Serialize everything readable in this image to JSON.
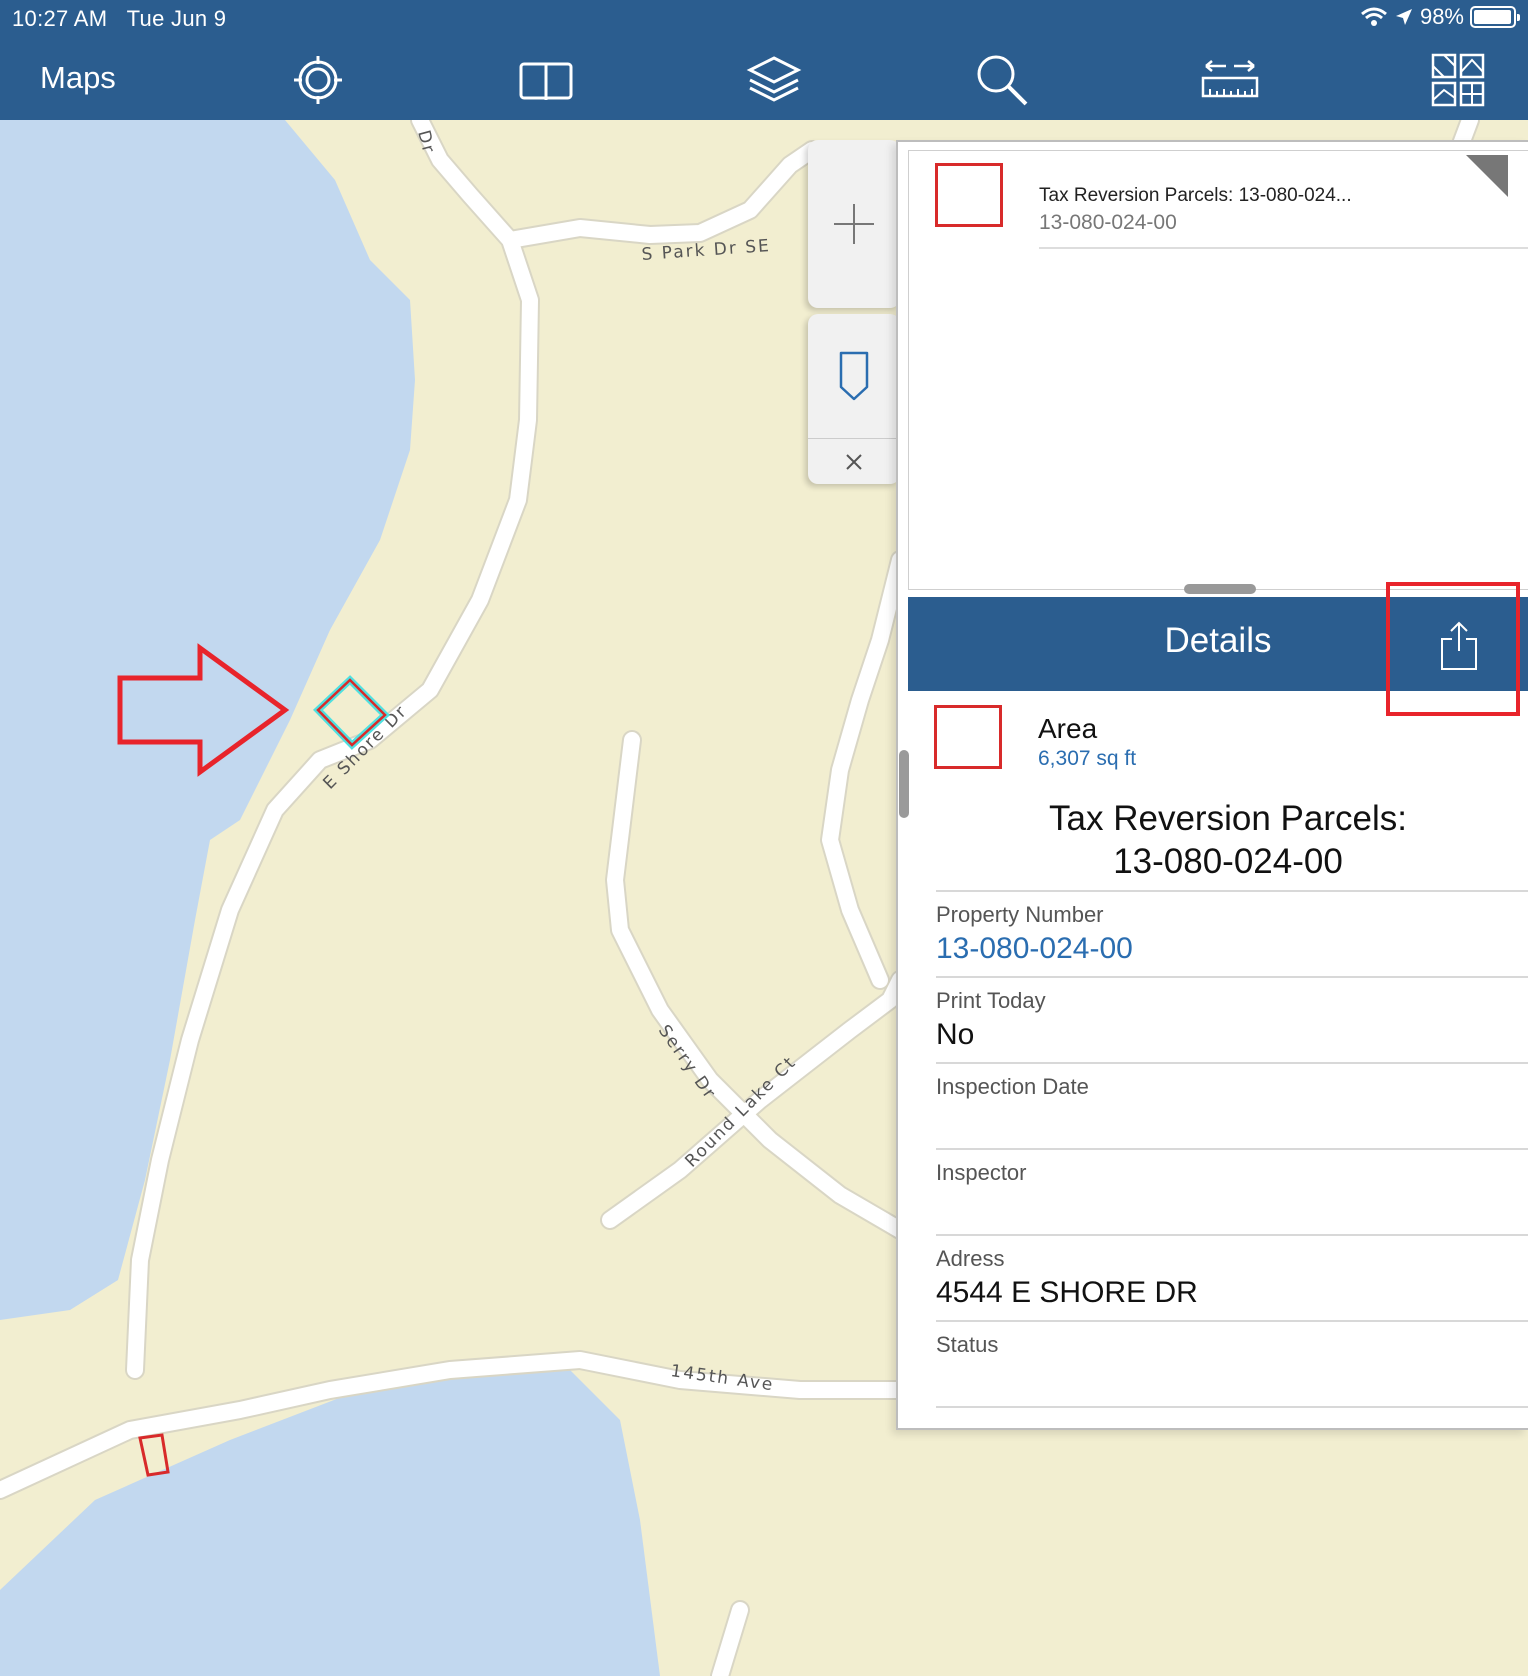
{
  "status_bar": {
    "time": "10:27 AM",
    "date": "Tue Jun 9",
    "battery": "98%",
    "battery_level": 0.98,
    "icons": [
      "wifi-icon",
      "location-arrow-icon",
      "battery-icon"
    ]
  },
  "toolbar": {
    "title": "Maps",
    "tools": [
      "locate-icon",
      "bookmarks-icon",
      "layers-icon",
      "search-icon",
      "measure-icon",
      "basemap-gallery-icon"
    ]
  },
  "map": {
    "road_labels": {
      "park_dr_se": "S Park Dr SE",
      "e_shore_dr": "E Shore Dr",
      "serry_dr": "Serry Dr",
      "round_lake_ct": "Round Lake Ct",
      "ave_145th": "145th Ave",
      "partial_top": "Dr"
    },
    "colors": {
      "water": "#c2d8ef",
      "land": "#f2eed0",
      "road": "#ffffff",
      "parcel_outline": "#d82a2a",
      "selection_glow": "#4fe0e0",
      "annotation_red": "#e8242b"
    }
  },
  "controls": {
    "zoom_icon": "plus-icon",
    "pin_icon": "pin-icon",
    "close_icon": "close-icon"
  },
  "results": {
    "item": {
      "title": "Tax Reversion Parcels: 13-080-024...",
      "subtitle": "13-080-024-00"
    }
  },
  "details": {
    "header": "Details",
    "share_icon": "share-icon",
    "area_label": "Area",
    "area_value": "6,307 sq ft",
    "feature_title_line1": "Tax Reversion Parcels:",
    "feature_title_line2": "13-080-024-00",
    "fields": [
      {
        "label": "Property Number",
        "value": "13-080-024-00"
      },
      {
        "label": "Print Today",
        "value": "No"
      },
      {
        "label": "Inspection Date",
        "value": ""
      },
      {
        "label": "Inspector",
        "value": ""
      },
      {
        "label": "Adress",
        "value": "4544 E SHORE DR"
      },
      {
        "label": "Status",
        "value": ""
      }
    ]
  }
}
